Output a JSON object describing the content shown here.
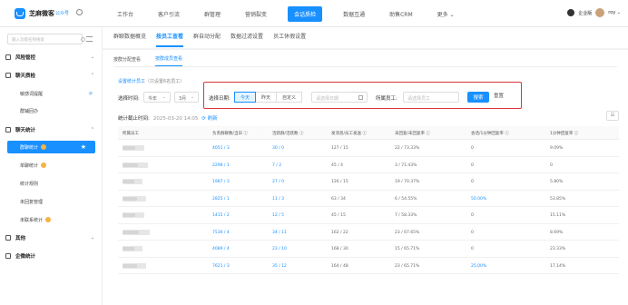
{
  "app": {
    "brand": "芝麻微客",
    "brand_sub": "公众号"
  },
  "topnav": {
    "items": [
      "工作台",
      "客户引流",
      "群管理",
      "营销裂变",
      "会话质检",
      "数据互通",
      "助售CRM",
      "更多 ⌄"
    ],
    "active_index": 4
  },
  "user": {
    "badge": "企业版",
    "name": "roy ⌄"
  },
  "sidebar": {
    "search_placeholder": "输入功能名称搜索",
    "groups": [
      {
        "label": "风险管控",
        "arrow": "⌄"
      },
      {
        "label": "聊天质检",
        "arrow": "⌃",
        "items": [
          "敏感词提醒",
          "群辅回办"
        ]
      },
      {
        "label": "聊天统计",
        "arrow": "⌃",
        "items": [
          "群聊统计",
          "单聊统计",
          "统计规则",
          "未回复管理",
          "未联系统计"
        ]
      },
      {
        "label": "其他",
        "arrow": "⌄"
      },
      {
        "label": "企微统计",
        "arrow": ""
      }
    ],
    "active_item": "群聊统计"
  },
  "tabs": [
    "群聊数据概览",
    "按员工查看",
    "群自动分配",
    "数据过滤设置",
    "员工休假设置"
  ],
  "active_tab_index": 1,
  "subtabs": [
    "按群分配查看",
    "按群成员查看"
  ],
  "active_subtab_index": 1,
  "filters": {
    "title": "设置统计员工",
    "title_note": "（只设置6名员工）",
    "time_label": "选择时间:",
    "year_value": "今年",
    "month_value": "3月",
    "date_label": "选择日期:",
    "date_buttons": [
      "今天",
      "昨天",
      "自定义"
    ],
    "date_active_index": 0,
    "date_placeholder": "请选择日期",
    "employee_label": "所属员工:",
    "employee_placeholder": "请选择员工",
    "search_button": "搜索",
    "reset_button": "重置"
  },
  "deadline": {
    "label": "统计截止时间:",
    "value": "2025-03-20 14:05",
    "refresh": "刷新"
  },
  "grid_button": "☷",
  "table": {
    "columns": [
      "所属员工",
      "负责群聊数/当日 ⓘ",
      "活跃群/活跃数 ⓘ",
      "发消息/员工发送 ⓘ",
      "未回复/未回复率 ⓘ",
      "会话/1分钟回复率 ⓘ",
      "1分钟回复率 ⓘ"
    ],
    "rows": [
      [
        "4051 / 3",
        "30 / 0",
        "127 / 15",
        "22 / 73.33%",
        "0",
        "9.09%"
      ],
      [
        "2298 / 1",
        "7 / 2",
        "45 / 4",
        "3 / 71.43%",
        "0",
        "0"
      ],
      [
        "1987 / 3",
        "27 / 0",
        "126 / 15",
        "19 / 70.37%",
        "0",
        "5.80%"
      ],
      [
        "2825 / 1",
        "11 / 3",
        "63 / 34",
        "6 / 54.55%",
        "50.00%",
        "53.85%"
      ],
      [
        "1415 / 2",
        "12 / 5",
        "45 / 15",
        "7 / 58.33%",
        "0",
        "15.11%"
      ],
      [
        "7536 / 4",
        "34 / 11",
        "162 / 22",
        "23 / 67.65%",
        "0",
        "8.69%"
      ],
      [
        "4089 / 4",
        "23 / 10",
        "168 / 30",
        "15 / 65.71%",
        "0",
        "23.33%"
      ],
      [
        "7621 / 3",
        "35 / 12",
        "164 / 48",
        "23 / 65.71%",
        "25.00%",
        "17.14%"
      ]
    ],
    "link_columns": [
      1,
      2
    ],
    "link_cell_flags": [
      [
        false,
        false,
        false,
        false,
        false,
        false
      ],
      [
        false,
        false,
        false,
        false,
        false,
        false
      ],
      [
        false,
        false,
        false,
        false,
        false,
        false
      ],
      [
        false,
        false,
        false,
        false,
        true,
        false
      ],
      [
        false,
        false,
        false,
        false,
        false,
        false
      ],
      [
        false,
        false,
        false,
        false,
        false,
        false
      ],
      [
        false,
        false,
        false,
        false,
        false,
        false
      ],
      [
        false,
        false,
        false,
        false,
        true,
        false
      ]
    ]
  }
}
